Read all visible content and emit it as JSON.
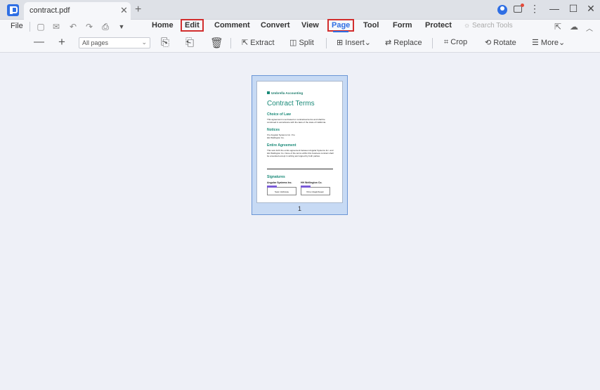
{
  "tab": {
    "title": "contract.pdf",
    "close": "✕",
    "new": "+"
  },
  "window": {
    "kebab": "⋮",
    "minimize": "—",
    "maximize": "☐",
    "close": "✕"
  },
  "menu": {
    "file": "File",
    "items": [
      "Home",
      "Edit",
      "Comment",
      "Convert",
      "View",
      "Page",
      "Tool",
      "Form",
      "Protect"
    ],
    "search_placeholder": "Search Tools"
  },
  "toolbar": {
    "page_select": "All pages",
    "extract": "Extract",
    "split": "Split",
    "insert": "Insert",
    "replace": "Replace",
    "crop": "Crop",
    "rotate": "Rotate",
    "more": "More"
  },
  "document": {
    "page_number": "1",
    "brand": "Umbrella Accounting",
    "title": "Contract Terms",
    "sections": [
      {
        "heading": "Choice of Law",
        "body": "This agreement is set based on contractual terms and shall be construed in accordance with the laws of the state of California."
      },
      {
        "heading": "Notices",
        "body": "If to Angular Systems Inc. If to HH Wellington Co."
      },
      {
        "heading": "Entire Agreement",
        "body": "This sets forth the entire agreement between Angular Systems Inc. and HH Wellington Co. None of the terms within this business contract shall be amended except in writing and signed by both parties."
      }
    ],
    "signatures_heading": "Signatures",
    "signers": [
      {
        "company": "Angular Systems Inc.",
        "name": "Sean Holloway"
      },
      {
        "company": "HH Wellington Co.",
        "name": "Vinny Higginbogen"
      }
    ]
  },
  "colors": {
    "accent": "#2f6fe4",
    "highlight": "#d22e2e",
    "doc_green": "#1a8a78"
  }
}
